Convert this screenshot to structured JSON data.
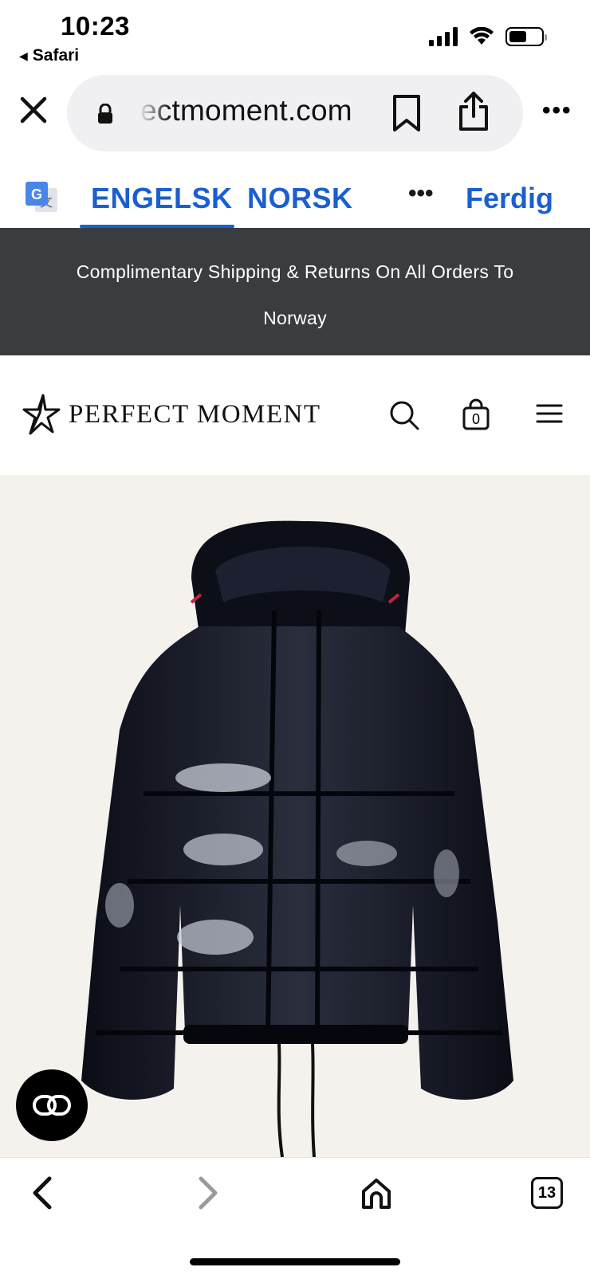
{
  "status_bar": {
    "time": "10:23",
    "back_app": "Safari",
    "icons": [
      "cellular-signal-icon",
      "wifi-icon",
      "battery-icon"
    ]
  },
  "browser": {
    "url_display": "ectmoment.com",
    "icons": [
      "close-icon",
      "lock-icon",
      "bookmark-icon",
      "share-icon",
      "more-icon"
    ]
  },
  "translate": {
    "source_lang": "ENGELSK",
    "target_lang": "NORSK",
    "more": "•••",
    "done": "Ferdig",
    "accent_color": "#1a5fd0"
  },
  "promo": {
    "text": "Complimentary Shipping & Returns On All Orders To Norway",
    "background": "#3a3d40"
  },
  "site": {
    "brand": "PERFECT MOMENT",
    "cart_count": "0",
    "icons": [
      "star-logo-icon",
      "search-icon",
      "shopping-bag-icon",
      "hamburger-menu-icon"
    ]
  },
  "product": {
    "image_desc_icon": "black-glossy-puffer-jacket-image",
    "background": "#f5f2ee"
  },
  "toolbar": {
    "tab_count": "13",
    "icons": [
      "chevron-left-icon",
      "chevron-right-icon",
      "home-icon",
      "tabs-icon"
    ]
  }
}
